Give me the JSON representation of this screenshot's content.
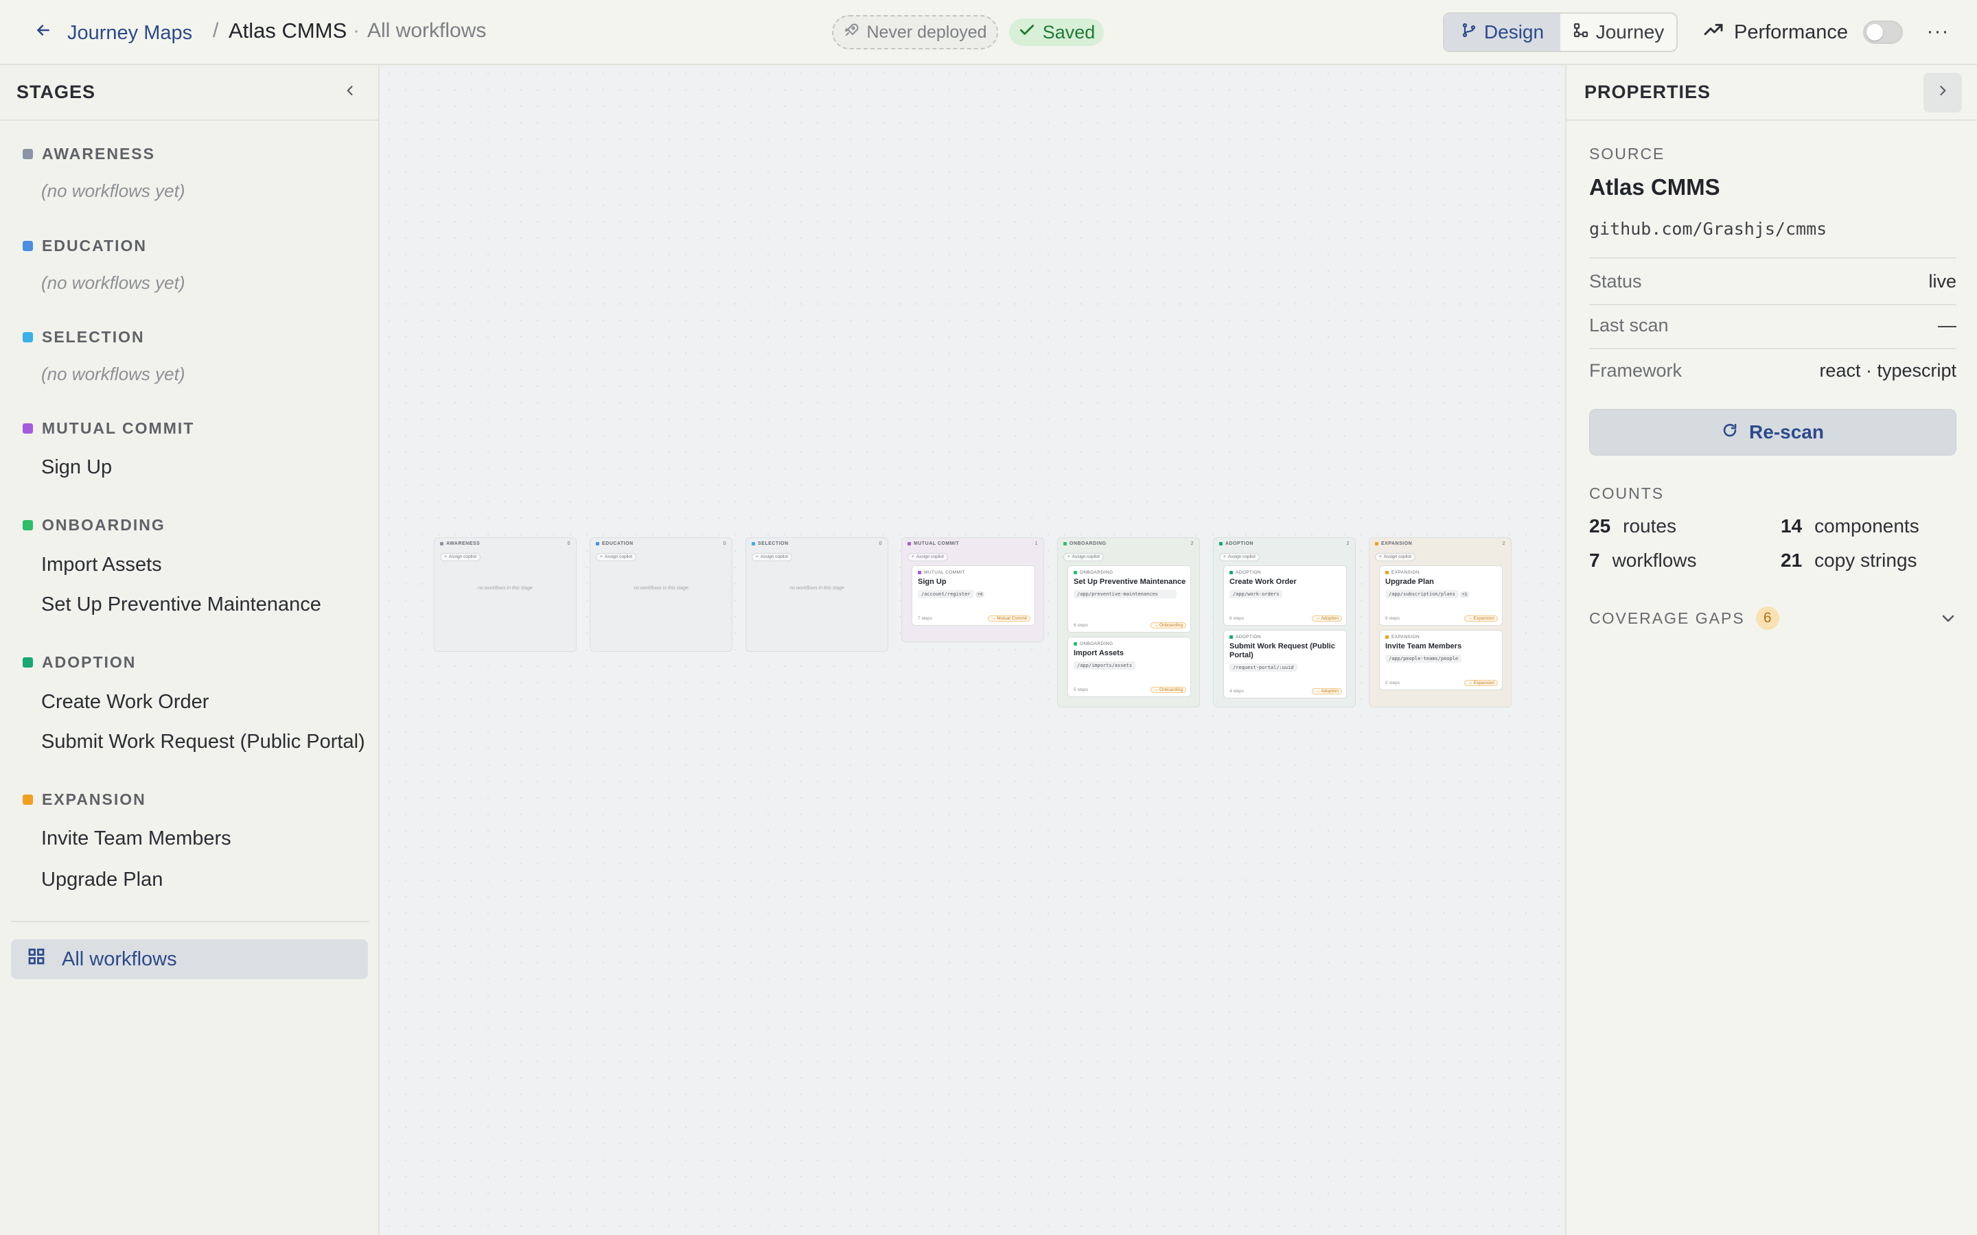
{
  "header": {
    "back_label": "Journey Maps",
    "breadcrumb_sep": "/",
    "project_title": "Atlas CMMS",
    "crumb_dot": "·",
    "view_label": "All workflows",
    "deploy_status": "Never deployed",
    "save_status": "Saved",
    "modes": [
      {
        "label": "Design",
        "active": true,
        "icon": "design-branch-icon"
      },
      {
        "label": "Journey",
        "active": false,
        "icon": "journey-nodes-icon"
      }
    ],
    "performance_label": "Performance",
    "performance_enabled": false,
    "more_label": "···"
  },
  "sidebar": {
    "title": "STAGES",
    "stages": [
      {
        "name": "AWARENESS",
        "color": "#8a94a6",
        "empty_text": "(no workflows yet)",
        "items": []
      },
      {
        "name": "EDUCATION",
        "color": "#4a8fe0",
        "empty_text": "(no workflows yet)",
        "items": []
      },
      {
        "name": "SELECTION",
        "color": "#3ab0e6",
        "empty_text": "(no workflows yet)",
        "items": []
      },
      {
        "name": "MUTUAL COMMIT",
        "color": "#a45be0",
        "items": [
          "Sign Up"
        ]
      },
      {
        "name": "ONBOARDING",
        "color": "#2ebd6a",
        "items": [
          "Import Assets",
          "Set Up Preventive Maintenance"
        ]
      },
      {
        "name": "ADOPTION",
        "color": "#17a874",
        "items": [
          "Create Work Order",
          "Submit Work Request (Public Portal)"
        ]
      },
      {
        "name": "EXPANSION",
        "color": "#f0a020",
        "items": [
          "Invite Team Members",
          "Upgrade Plan"
        ]
      }
    ],
    "all_workflows_label": "All workflows"
  },
  "canvas": {
    "assign_label": "Assign copilot",
    "columns": [
      {
        "stage": "AWARENESS",
        "color": "#8a94a6",
        "count": "0",
        "bg": "#eceeef",
        "empty_text": "no workflows in this stage",
        "cards": []
      },
      {
        "stage": "EDUCATION",
        "color": "#4a8fe0",
        "count": "0",
        "bg": "#eceeef",
        "empty_text": "no workflows in this stage",
        "cards": []
      },
      {
        "stage": "SELECTION",
        "color": "#3ab0e6",
        "count": "0",
        "bg": "#eceeef",
        "empty_text": "no workflows in this stage",
        "cards": []
      },
      {
        "stage": "MUTUAL COMMIT",
        "color": "#a45be0",
        "count": "1",
        "bg": "#efeaf2",
        "cards": [
          {
            "stage": "MUTUAL COMMIT",
            "title": "Sign Up",
            "route": "/account/register",
            "extra": "+4",
            "steps": "7 steps",
            "tag": "→ Mutual Commit"
          }
        ]
      },
      {
        "stage": "ONBOARDING",
        "color": "#2ebd6a",
        "count": "2",
        "bg": "#e8efe9",
        "cards": [
          {
            "stage": "ONBOARDING",
            "title": "Set Up Preventive Maintenance",
            "route": "/app/preventive-maintenances",
            "extra": "",
            "steps": "6 steps",
            "tag": "→ Onboarding"
          },
          {
            "stage": "ONBOARDING",
            "title": "Import Assets",
            "route": "/app/imports/assets",
            "extra": "",
            "steps": "5 steps",
            "tag": "→ Onboarding"
          }
        ]
      },
      {
        "stage": "ADOPTION",
        "color": "#17a874",
        "count": "2",
        "bg": "#e8efec",
        "cards": [
          {
            "stage": "ADOPTION",
            "title": "Create Work Order",
            "route": "/app/work-orders",
            "extra": "",
            "steps": "6 steps",
            "tag": "→ Adoption"
          },
          {
            "stage": "ADOPTION",
            "title": "Submit Work Request (Public Portal)",
            "route": "/request-portal/:uuid",
            "extra": "",
            "steps": "4 steps",
            "tag": "→ Adoption"
          }
        ]
      },
      {
        "stage": "EXPANSION",
        "color": "#f0a020",
        "count": "2",
        "bg": "#f0ece4",
        "cards": [
          {
            "stage": "EXPANSION",
            "title": "Upgrade Plan",
            "route": "/app/subscription/plans",
            "extra": "+1",
            "steps": "6 steps",
            "tag": "→ Expansion"
          },
          {
            "stage": "EXPANSION",
            "title": "Invite Team Members",
            "route": "/app/people-teams/people",
            "extra": "",
            "steps": "5 steps",
            "tag": "→ Expansion"
          }
        ]
      }
    ]
  },
  "properties": {
    "title": "PROPERTIES",
    "source_label": "SOURCE",
    "source_name": "Atlas CMMS",
    "source_repo": "github.com/Grashjs/cmms",
    "status_label": "Status",
    "status_value": "live",
    "last_scan_label": "Last scan",
    "last_scan_value": "—",
    "framework_label": "Framework",
    "framework_value": "react · typescript",
    "rescan_label": "Re-scan",
    "counts_label": "COUNTS",
    "counts": [
      {
        "value": "25",
        "label": "routes"
      },
      {
        "value": "14",
        "label": "components"
      },
      {
        "value": "7",
        "label": "workflows"
      },
      {
        "value": "21",
        "label": "copy strings"
      }
    ],
    "coverage_label": "COVERAGE GAPS",
    "coverage_count": "6"
  }
}
